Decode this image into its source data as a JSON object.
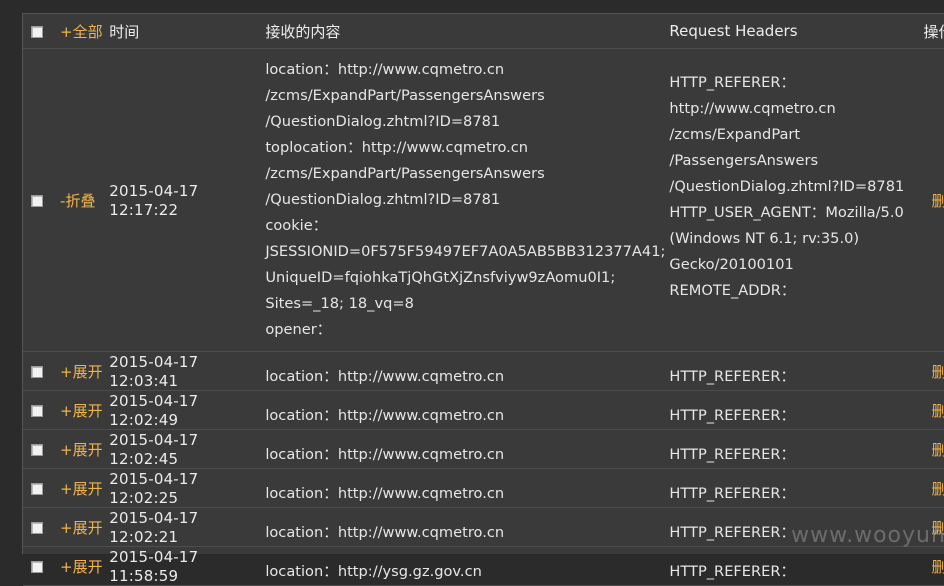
{
  "header": {
    "toggle_all": "+全部",
    "time": "时间",
    "content": "接收的内容",
    "headers": "Request Headers",
    "ops": "操作"
  },
  "expanded": {
    "toggle": "-折叠",
    "time": "2015-04-17 12:17:22",
    "content_lines": [
      "location：http://www.cqmetro.cn",
      "/zcms/ExpandPart/PassengersAnswers",
      "/QuestionDialog.zhtml?ID=8781",
      "toplocation：http://www.cqmetro.cn",
      "/zcms/ExpandPart/PassengersAnswers",
      "/QuestionDialog.zhtml?ID=8781",
      "cookie：",
      "JSESSIONID=0F575F59497EF7A0A5AB5BB312377A41;",
      "UniqueID=fqiohkaTjQhGtXjZnsfviyw9zAomu0I1;",
      "Sites=_18; 18_vq=8",
      "opener："
    ],
    "header_lines": [
      "HTTP_REFERER：",
      "http://www.cqmetro.cn",
      "/zcms/ExpandPart",
      "/PassengersAnswers",
      "/QuestionDialog.zhtml?ID=8781",
      "HTTP_USER_AGENT：Mozilla/5.0",
      "(Windows NT 6.1; rv:35.0)",
      "Gecko/20100101",
      "REMOTE_ADDR：",
      ""
    ],
    "op": "删除"
  },
  "rows": [
    {
      "toggle": "+展开",
      "time": "2015-04-17 12:03:41",
      "content": "location：http://www.cqmetro.cn",
      "headers": "HTTP_REFERER：",
      "op": "删除"
    },
    {
      "toggle": "+展开",
      "time": "2015-04-17 12:02:49",
      "content": "location：http://www.cqmetro.cn",
      "headers": "HTTP_REFERER：",
      "op": "删除"
    },
    {
      "toggle": "+展开",
      "time": "2015-04-17 12:02:45",
      "content": "location：http://www.cqmetro.cn",
      "headers": "HTTP_REFERER：",
      "op": "删除"
    },
    {
      "toggle": "+展开",
      "time": "2015-04-17 12:02:25",
      "content": "location：http://www.cqmetro.cn",
      "headers": "HTTP_REFERER：",
      "op": "删除"
    },
    {
      "toggle": "+展开",
      "time": "2015-04-17 12:02:21",
      "content": "location：http://www.cqmetro.cn",
      "headers": "HTTP_REFERER：",
      "op": "删除"
    },
    {
      "toggle": "+展开",
      "time": "2015-04-17 11:58:59",
      "content": "location：http://ysg.gz.gov.cn",
      "headers": "HTTP_REFERER：",
      "op": "删除"
    }
  ],
  "watermark": "www.wooyun.org",
  "colors": {
    "accent": "#f0b44a",
    "bg": "#3b3a3b"
  }
}
